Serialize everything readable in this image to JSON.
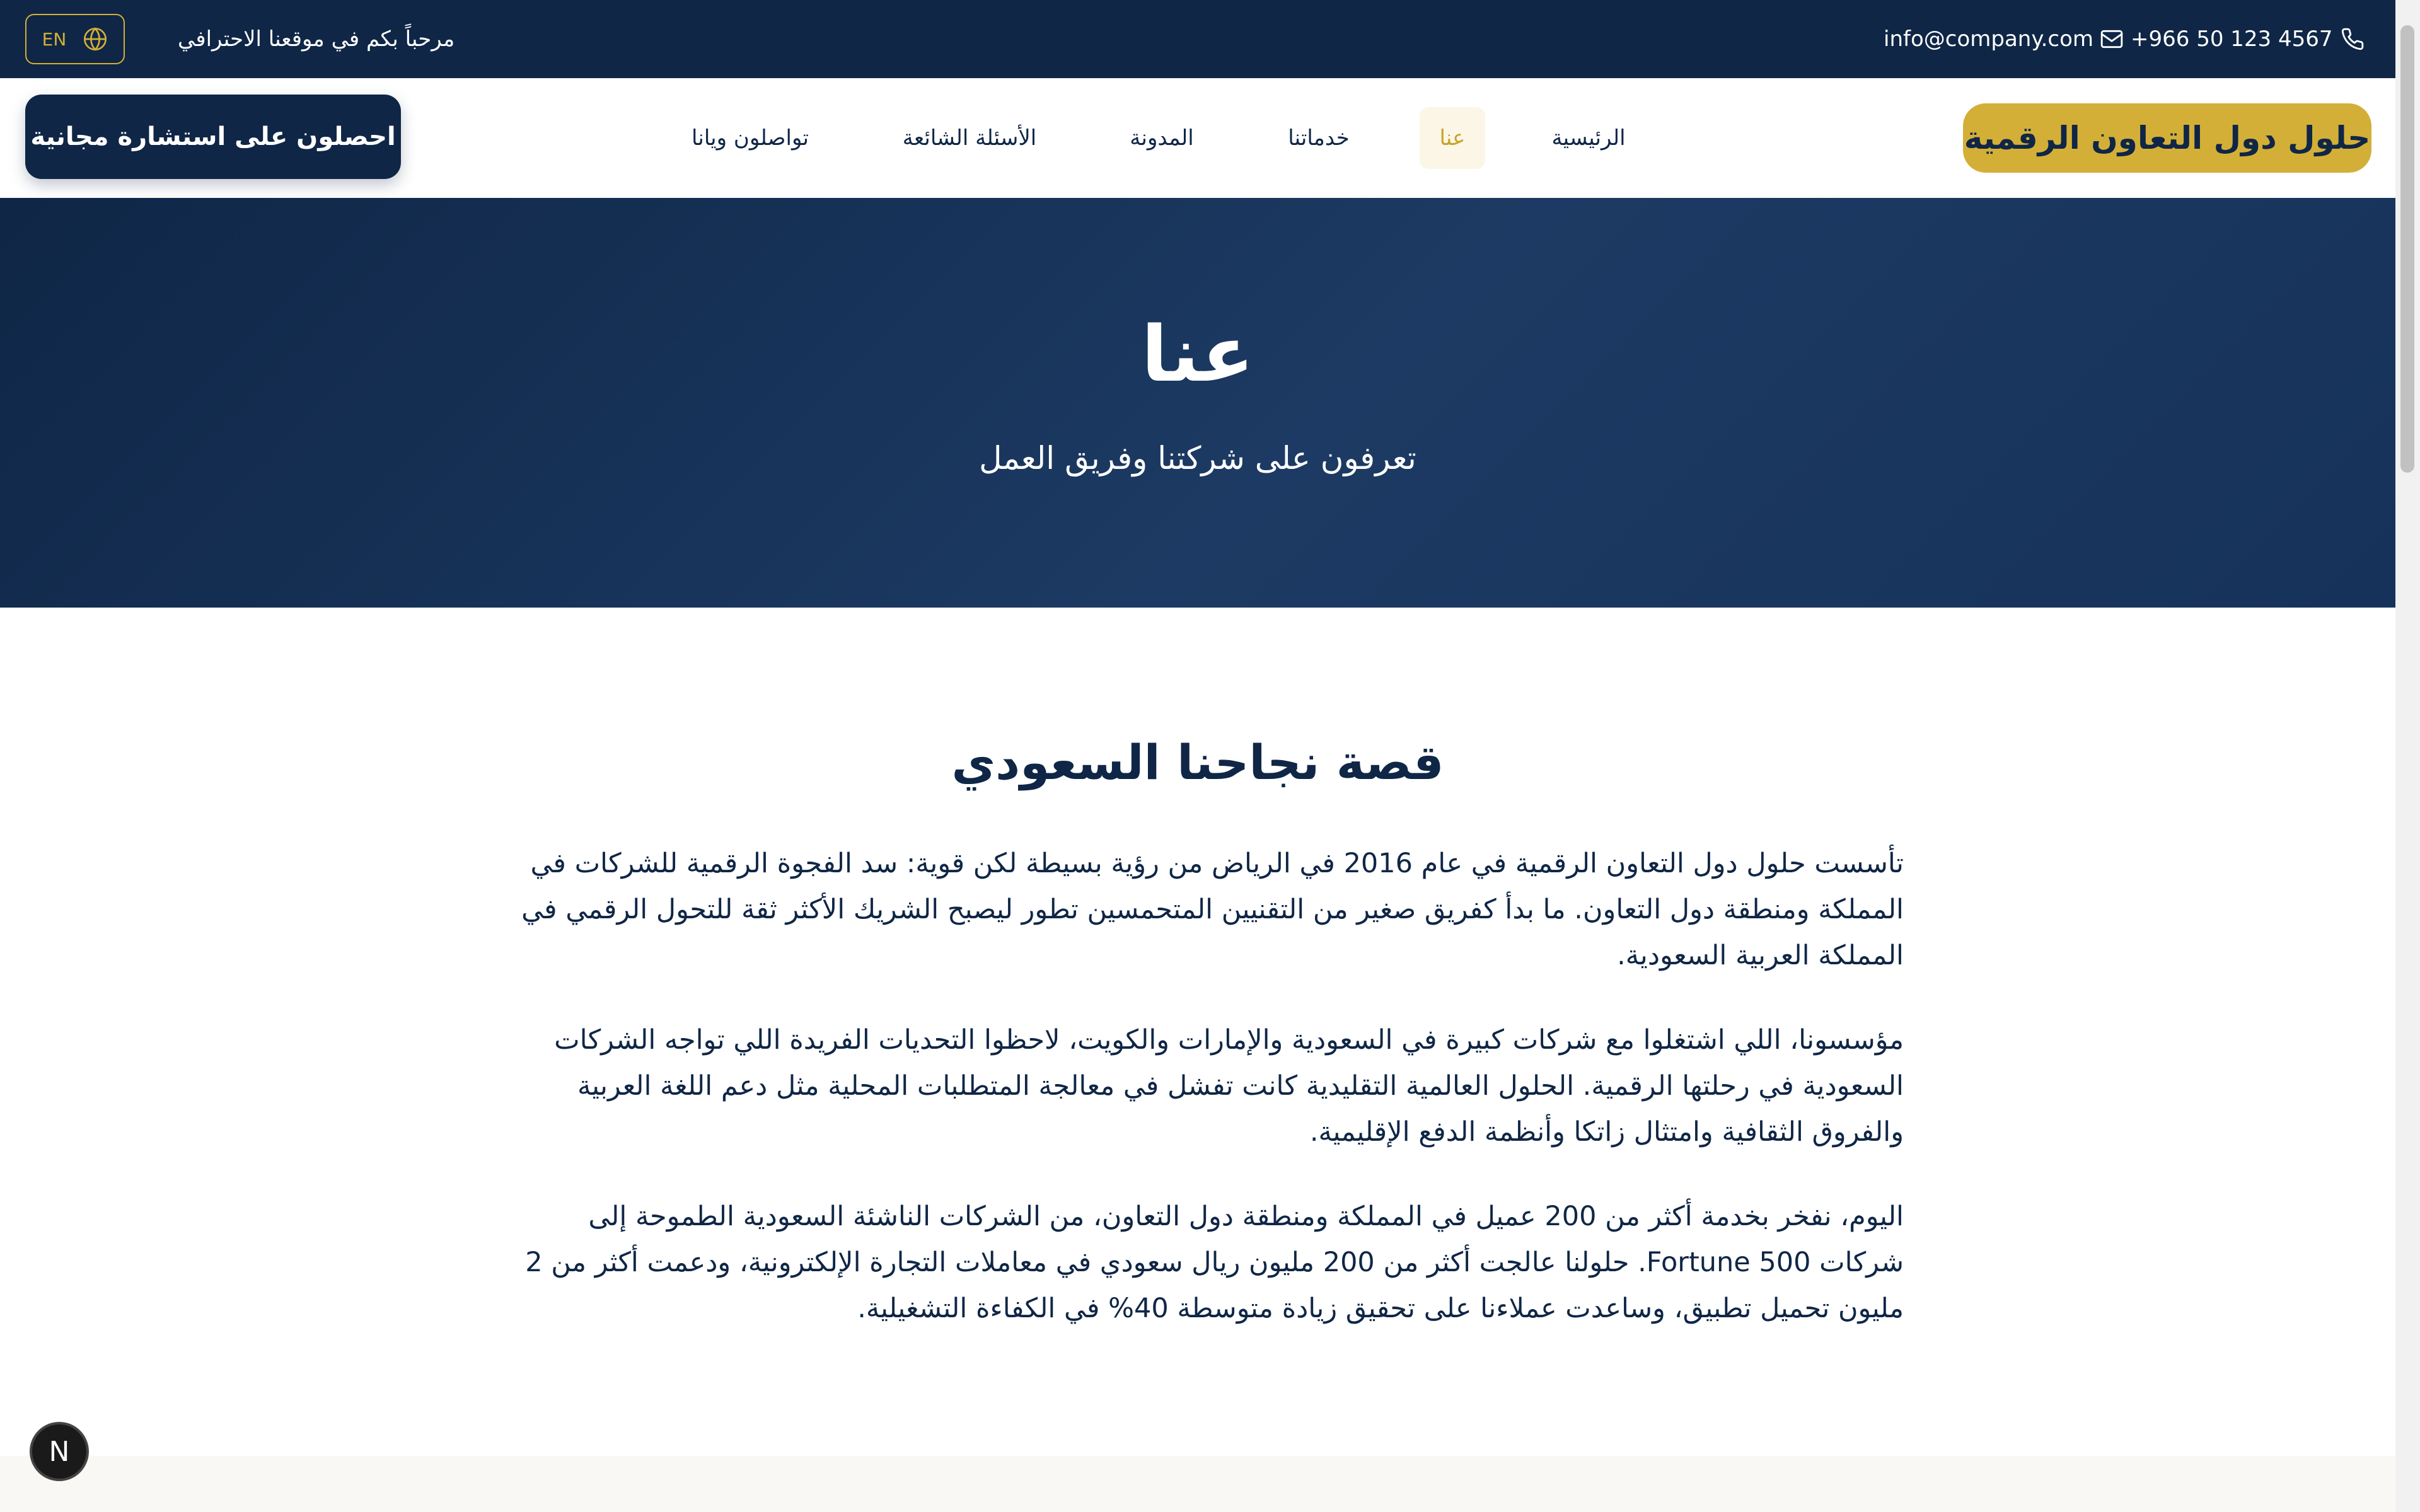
{
  "topbar": {
    "phone": "+966 50 123 4567",
    "email": "info@company.com",
    "welcome": "مرحباً بكم في موقعنا الاحترافي",
    "lang_label": "EN"
  },
  "header": {
    "brand": "حلول دول التعاون الرقمية",
    "nav": [
      "الرئيسية",
      "عنا",
      "خدماتنا",
      "المدونة",
      "الأسئلة الشائعة",
      "تواصلون ويانا"
    ],
    "active_nav": "عنا",
    "cta": "احصلون على استشارة مجانية"
  },
  "hero": {
    "title": "عنا",
    "subtitle": "تعرفون على شركتنا وفريق العمل"
  },
  "story": {
    "title": "قصة نجاحنا السعودي",
    "paragraphs": [
      "تأسست حلول دول التعاون الرقمية في عام 2016 في الرياض من رؤية بسيطة لكن قوية: سد الفجوة الرقمية للشركات في المملكة ومنطقة دول التعاون. ما بدأ كفريق صغير من التقنيين المتحمسين تطور ليصبح الشريك الأكثر ثقة للتحول الرقمي في المملكة العربية السعودية.",
      "مؤسسونا، اللي اشتغلوا مع شركات كبيرة في السعودية والإمارات والكويت، لاحظوا التحديات الفريدة اللي تواجه الشركات السعودية في رحلتها الرقمية. الحلول العالمية التقليدية كانت تفشل في معالجة المتطلبات المحلية مثل دعم اللغة العربية والفروق الثقافية وامتثال زاتكا وأنظمة الدفع الإقليمية.",
      "اليوم، نفخر بخدمة أكثر من 200 عميل في المملكة ومنطقة دول التعاون، من الشركات الناشئة السعودية الطموحة إلى شركات Fortune 500. حلولنا عالجت أكثر من 200 مليون ريال سعودي في معاملات التجارة الإلكترونية، ودعمت أكثر من 2 مليون تحميل تطبيق، وساعدت عملاءنا على تحقيق زيادة متوسطة 40% في الكفاءة التشغيلية."
    ]
  },
  "dev_badge": "N",
  "colors": {
    "navy": "#0f2646",
    "gold": "#d4af37",
    "active_bg": "#fbf6e6"
  },
  "icons": [
    "phone-icon",
    "mail-icon",
    "globe-icon"
  ]
}
